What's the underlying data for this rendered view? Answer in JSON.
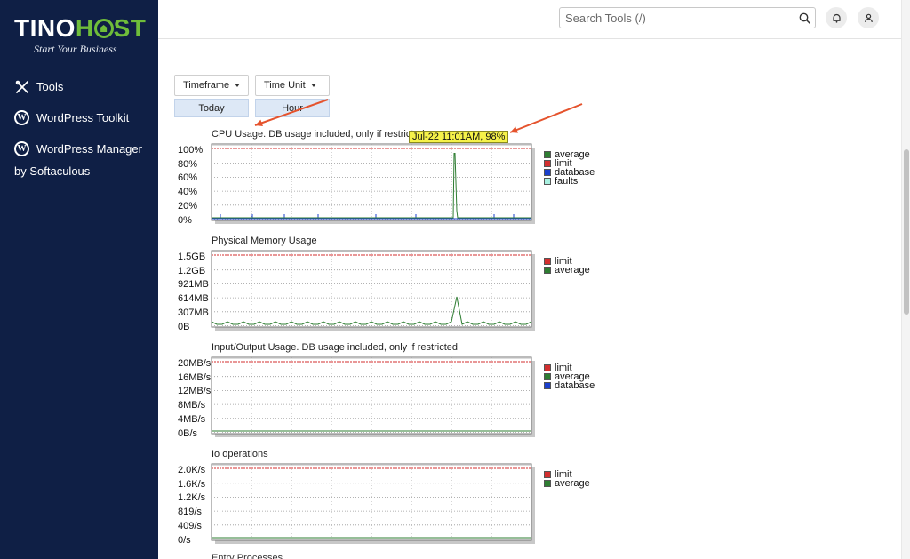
{
  "brand": {
    "name_a": "TINO",
    "name_b": "H",
    "name_c": "ST",
    "tagline": "Start Your Business"
  },
  "sidebar": {
    "items": [
      {
        "label": "Tools",
        "icon": "tools-icon"
      },
      {
        "label": "WordPress Toolkit",
        "icon": "wordpress-icon"
      },
      {
        "label": "WordPress Manager",
        "icon": "wordpress-icon"
      }
    ],
    "sub_label": "by Softaculous"
  },
  "search": {
    "placeholder": "Search Tools (/)"
  },
  "controls": {
    "timeframe": "Timeframe",
    "time_unit": "Time Unit",
    "today": "Today",
    "hour": "Hour"
  },
  "tooltip": "Jul-22 11:01AM, 98%",
  "colors": {
    "average": "#2e7d32",
    "limit": "#d32f2f",
    "database": "#1a3fcc",
    "faults": "#a8f0e0"
  },
  "charts": [
    {
      "title": "CPU Usage. DB usage included, only if restricted",
      "y_ticks": [
        "100%",
        "80%",
        "60%",
        "40%",
        "20%",
        "0%"
      ],
      "legend": [
        "average",
        "limit",
        "database",
        "faults"
      ],
      "ylim": [
        0,
        100
      ],
      "peak": {
        "label": "Jul-22 11:01AM",
        "value": 98
      }
    },
    {
      "title": "Physical Memory Usage",
      "y_ticks": [
        "1.5GB",
        "1.2GB",
        "921MB",
        "614MB",
        "307MB",
        "0B"
      ],
      "legend": [
        "limit",
        "average"
      ]
    },
    {
      "title": "Input/Output Usage. DB usage included, only if restricted",
      "y_ticks": [
        "20MB/s",
        "16MB/s",
        "12MB/s",
        "8MB/s",
        "4MB/s",
        "0B/s"
      ],
      "legend": [
        "limit",
        "average",
        "database"
      ]
    },
    {
      "title": "Io operations",
      "y_ticks": [
        "2.0K/s",
        "1.6K/s",
        "1.2K/s",
        "819/s",
        "409/s",
        "0/s"
      ],
      "legend": [
        "limit",
        "average"
      ]
    }
  ],
  "next_chart_title": "Entry Processes"
}
